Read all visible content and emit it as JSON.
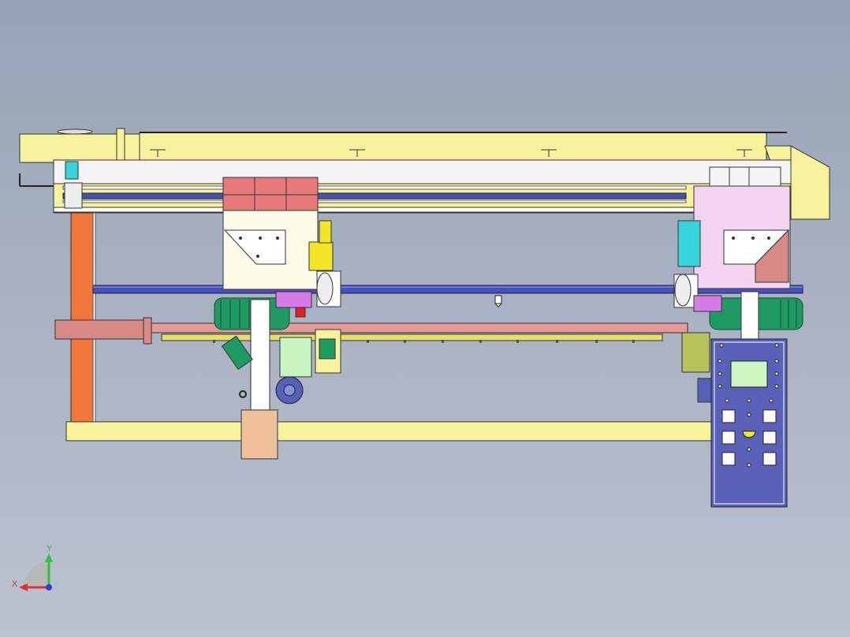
{
  "scene": {
    "kind": "CAD 3D assembly view",
    "view": "front",
    "background_top": "#97a4b7",
    "background_bottom": "#bbc3d0"
  },
  "colors": {
    "beam_yellow": "#f7f29c",
    "column_orange": "#f0763a",
    "motor_green": "#1f9a63",
    "panel_blue": "#5960b8",
    "rail_blue": "#4a4fc0",
    "rail_red": "#e49a96",
    "cylinder_pink": "#d88a86",
    "carriage_pink": "#f2d3f0",
    "accent_cyan": "#38d4dc",
    "accent_salmon": "#f0c09a"
  },
  "triad": {
    "x_label": "X",
    "y_label": "Y",
    "x_color": "#e03030",
    "y_color": "#30c040",
    "z_color": "#3040d0"
  },
  "control_panel": {
    "screen": "blank",
    "button_rows": 3,
    "buttons_per_row": 2,
    "indicator_lights": 14
  }
}
